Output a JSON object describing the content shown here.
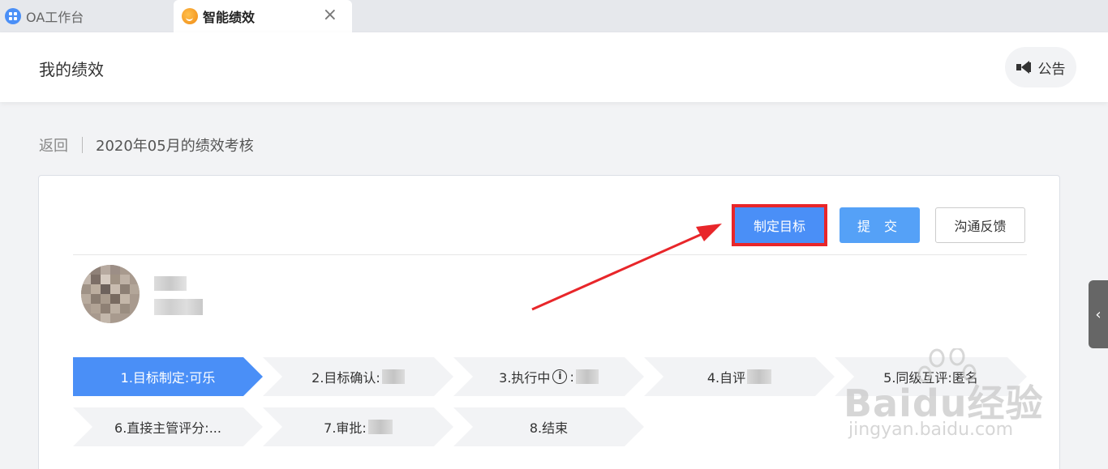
{
  "tabs": [
    {
      "label": "OA工作台",
      "icon": "grid-icon"
    },
    {
      "label": "智能绩效",
      "icon": "app-logo-icon",
      "close": "×"
    }
  ],
  "header": {
    "title": "我的绩效",
    "notice_label": "公告"
  },
  "breadcrumb": {
    "back": "返回",
    "current": "2020年05月的绩效考核"
  },
  "actions": {
    "set_goal": "制定目标",
    "submit": "提 交",
    "feedback": "沟通反馈"
  },
  "steps": [
    {
      "label": "1.目标制定:可乐",
      "active": true
    },
    {
      "label": "2.目标确认:"
    },
    {
      "label": "3.执行中",
      "suffix": ":"
    },
    {
      "label": "4.自评"
    },
    {
      "label": "5.同级互评:匿名"
    },
    {
      "label": "6.直接主管评分:..."
    },
    {
      "label": "7.审批:"
    },
    {
      "label": "8.结束"
    }
  ],
  "side_handle": "‹",
  "watermark": {
    "brand": "Baidu经验",
    "url": "jingyan.baidu.com"
  },
  "colors": {
    "primary": "#4a8ff7",
    "highlight": "#e8262a"
  }
}
